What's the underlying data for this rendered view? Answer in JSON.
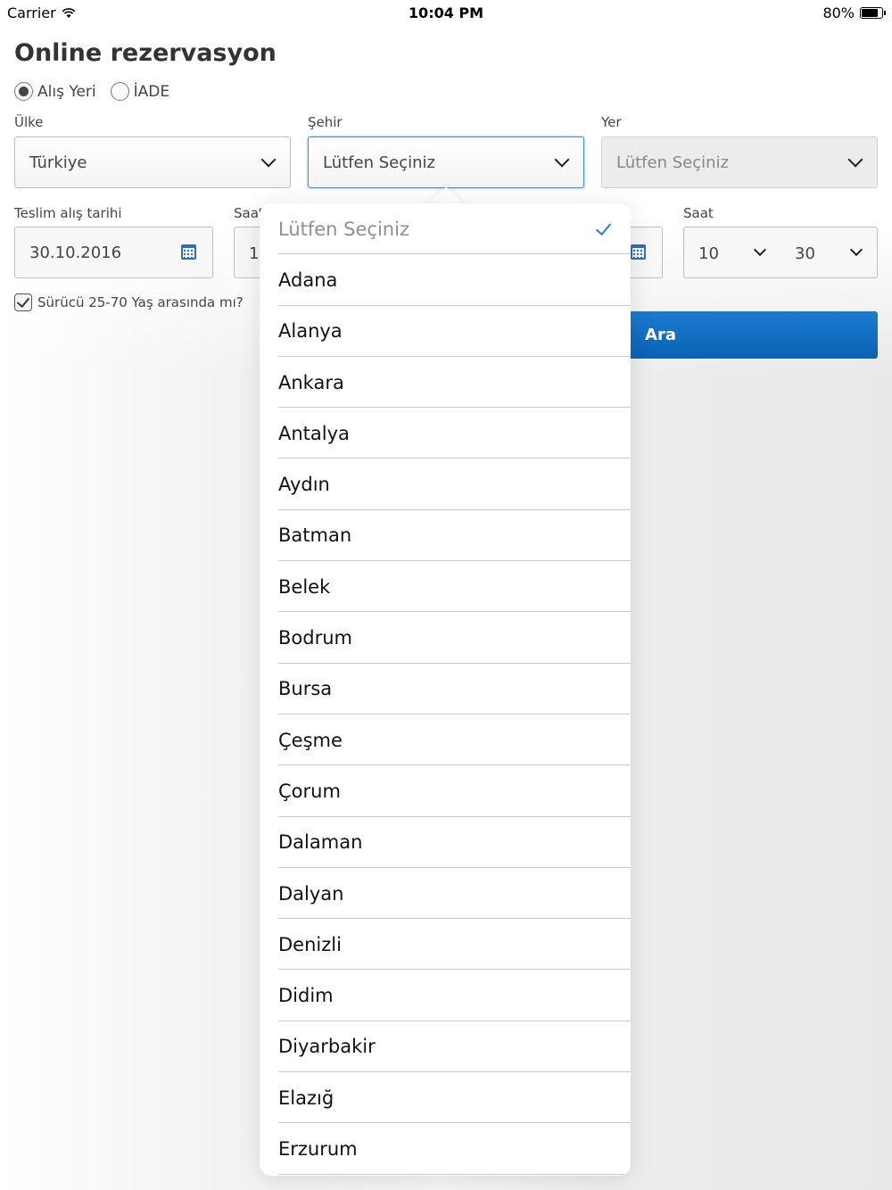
{
  "status_bar": {
    "carrier": "Carrier",
    "time": "10:04 PM",
    "battery": "80%",
    "battery_level": 0.8
  },
  "title": "Online rezervasyon",
  "radios": {
    "pickup": "Alış Yeri",
    "return": "İADE",
    "selected": "pickup"
  },
  "fields": {
    "country": {
      "label": "Ülke",
      "value": "Türkiye"
    },
    "city": {
      "label": "Şehir",
      "value": "Lütfen Seçiniz"
    },
    "place": {
      "label": "Yer",
      "value": "Lütfen Seçiniz"
    }
  },
  "pickup_date": {
    "label": "Teslim alış tarihi",
    "value": "30.10.2016"
  },
  "pickup_time": {
    "label": "Saat",
    "hour_visible": "1"
  },
  "return_time": {
    "label": "Saat",
    "hour": "10",
    "minute": "30"
  },
  "driver_check": {
    "label": "Sürücü 25-70 Yaş arasında mı?",
    "checked": true
  },
  "search_button": "Ara",
  "dropdown": {
    "selected_index": 0,
    "options": [
      "Lütfen Seçiniz",
      "Adana",
      "Alanya",
      "Ankara",
      "Antalya",
      "Aydın",
      "Batman",
      "Belek",
      "Bodrum",
      "Bursa",
      "Çeşme",
      "Çorum",
      "Dalaman",
      "Dalyan",
      "Denizli",
      "Didim",
      "Diyarbakir",
      "Elazığ",
      "Erzurum"
    ]
  },
  "colors": {
    "accent": "#1a7cf0",
    "button": "#0b62b4",
    "active_border": "#3a8fd6"
  }
}
